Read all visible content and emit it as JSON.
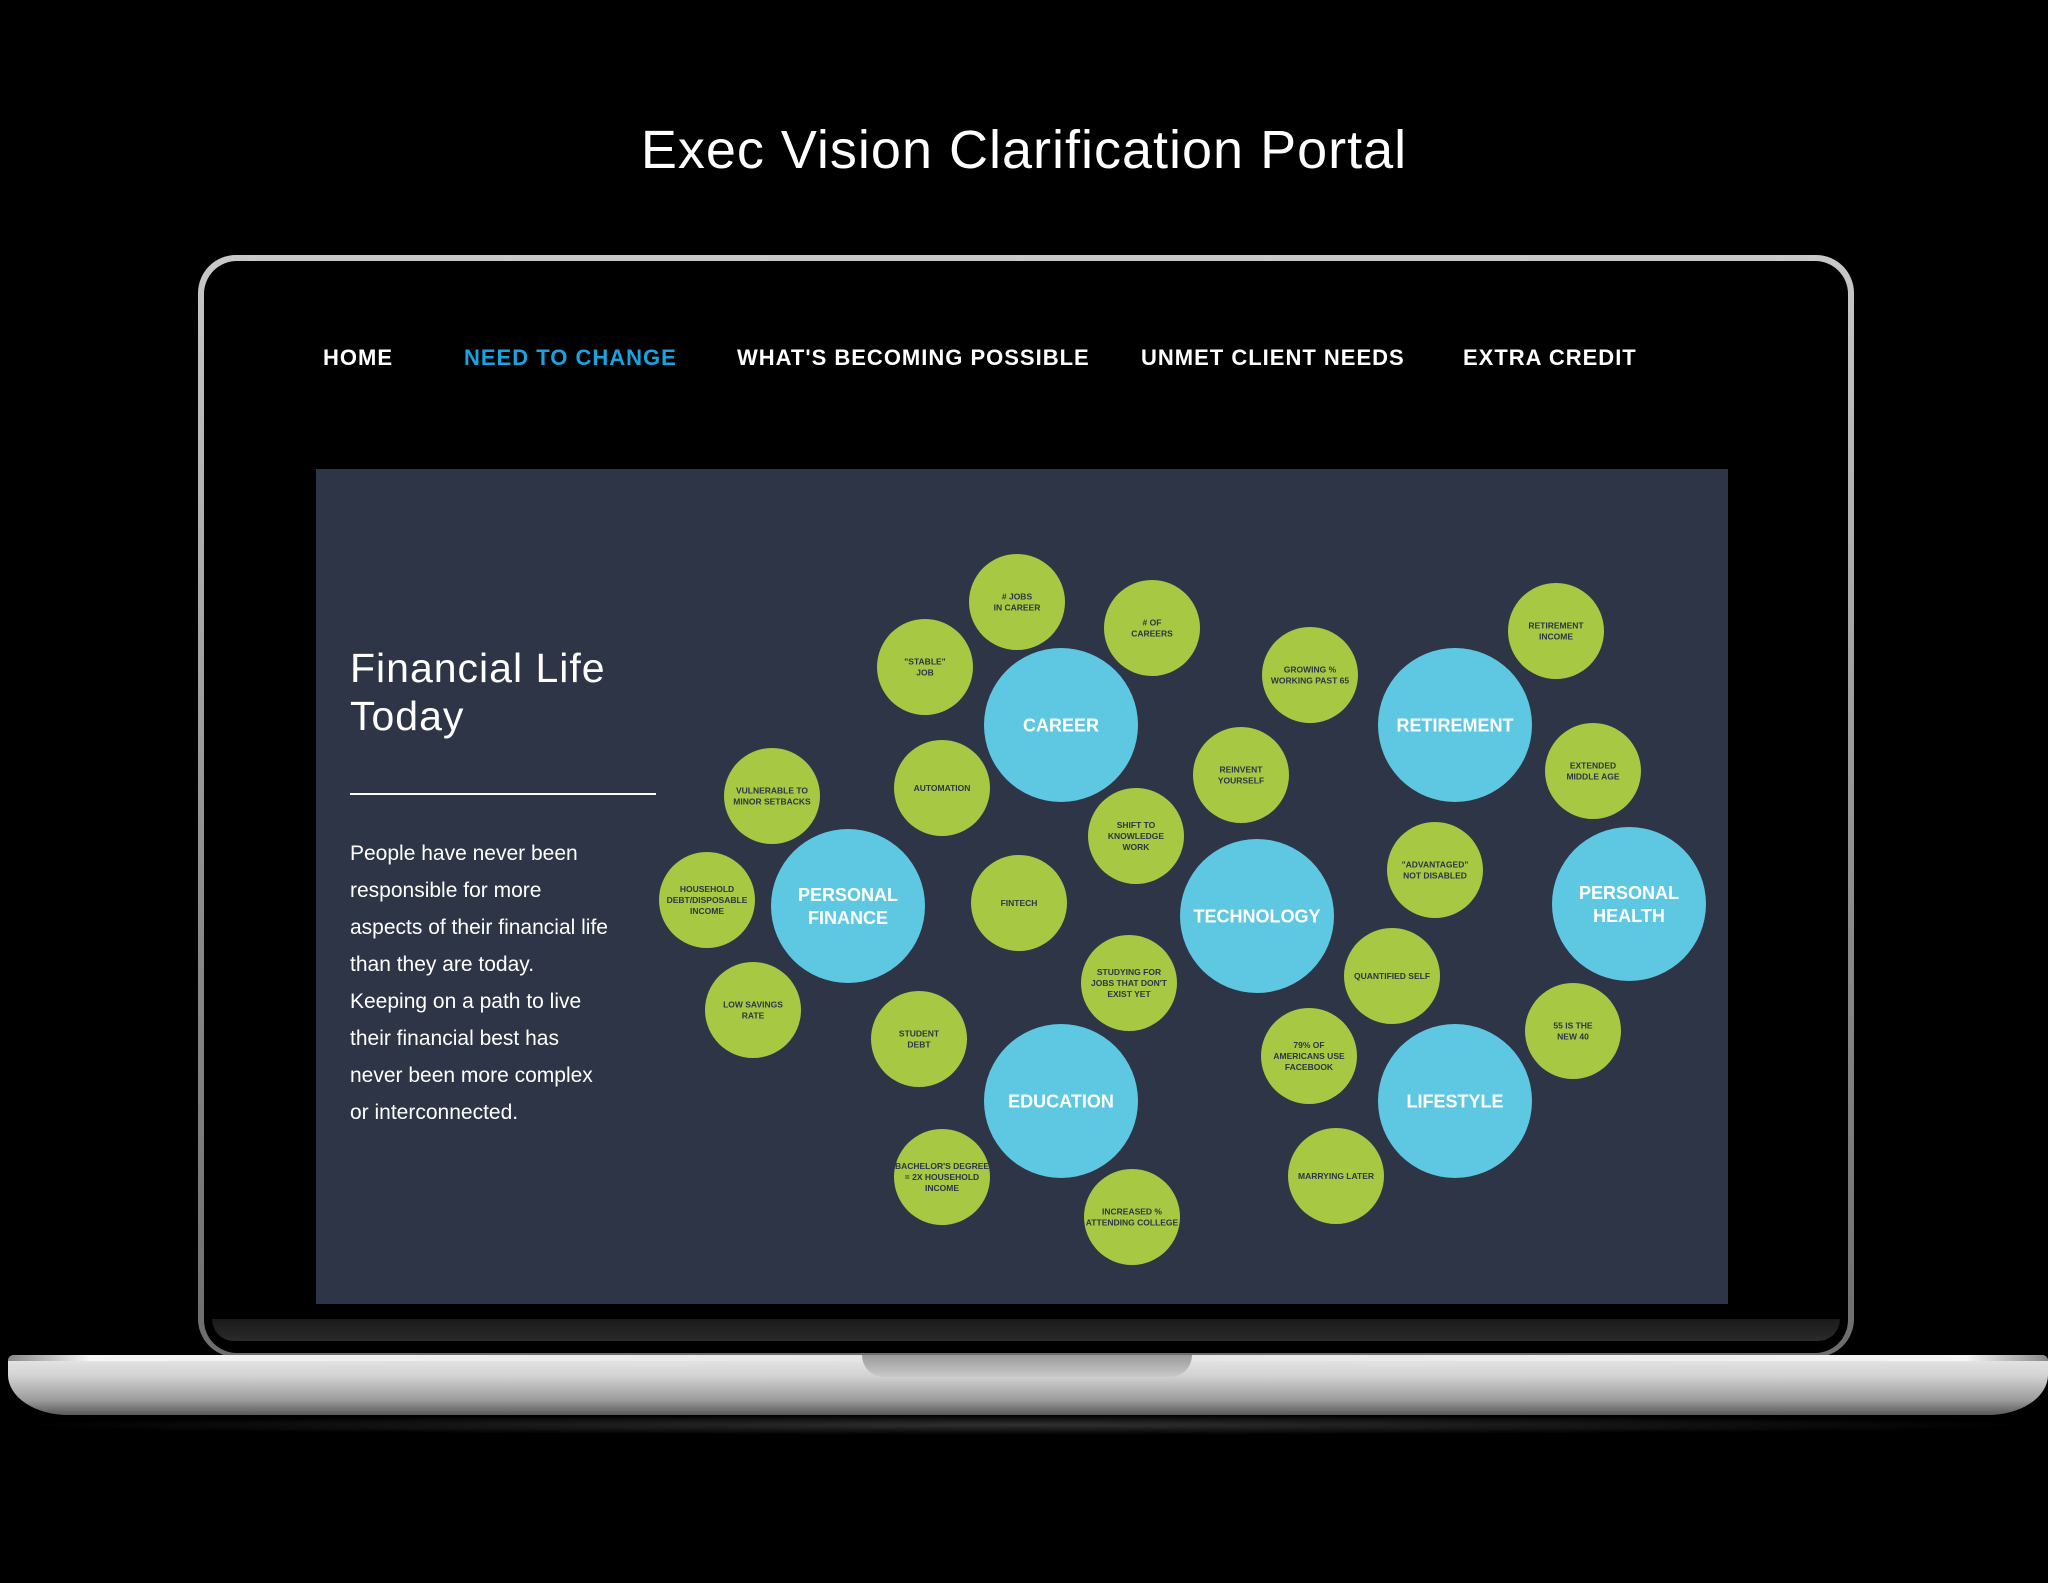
{
  "page_title": "Exec Vision Clarification Portal",
  "nav": {
    "items": [
      {
        "label": "HOME",
        "active": false
      },
      {
        "label": "NEED TO CHANGE",
        "active": true
      },
      {
        "label": "WHAT'S BECOMING POSSIBLE",
        "active": false
      },
      {
        "label": "UNMET CLIENT NEEDS",
        "active": false
      },
      {
        "label": "EXTRA CREDIT",
        "active": false
      }
    ]
  },
  "panel": {
    "heading_line1": "Financial Life",
    "heading_line2": "Today",
    "body_lines": [
      "People have never been",
      "responsible for more",
      "aspects of their financial life",
      "than they are today.",
      "Keeping on a path to live",
      "their financial best has",
      "never been more complex",
      "or interconnected."
    ]
  },
  "colors": {
    "background": "#000000",
    "panel": "#2d3546",
    "accent_blue": "#1aa3e0",
    "main_bubble": "#5ec8e3",
    "sub_bubble": "#a7c843",
    "sub_bubble_text": "#2d3546"
  },
  "bubbles": {
    "main": [
      {
        "id": "career",
        "lines": [
          "CAREER"
        ]
      },
      {
        "id": "retirement",
        "lines": [
          "RETIREMENT"
        ]
      },
      {
        "id": "personal-finance",
        "lines": [
          "PERSONAL",
          "FINANCE"
        ]
      },
      {
        "id": "technology",
        "lines": [
          "TECHNOLOGY"
        ]
      },
      {
        "id": "personal-health",
        "lines": [
          "PERSONAL",
          "HEALTH"
        ]
      },
      {
        "id": "education",
        "lines": [
          "EDUCATION"
        ]
      },
      {
        "id": "lifestyle",
        "lines": [
          "LIFESTYLE"
        ]
      }
    ],
    "sub": [
      {
        "id": "jobs-in-career",
        "lines": [
          "# JOBS",
          "IN CAREER"
        ]
      },
      {
        "id": "of-careers",
        "lines": [
          "# OF",
          "CAREERS"
        ]
      },
      {
        "id": "stable-job",
        "lines": [
          "\"STABLE\"",
          "JOB"
        ]
      },
      {
        "id": "retirement-income",
        "lines": [
          "RETIREMENT",
          "INCOME"
        ]
      },
      {
        "id": "growing-working",
        "lines": [
          "GROWING %",
          "WORKING PAST 65"
        ]
      },
      {
        "id": "vulnerable",
        "lines": [
          "VULNERABLE TO",
          "MINOR SETBACKS"
        ]
      },
      {
        "id": "automation",
        "lines": [
          "AUTOMATION"
        ]
      },
      {
        "id": "reinvent",
        "lines": [
          "REINVENT",
          "YOURSELF"
        ]
      },
      {
        "id": "extended-middle-age",
        "lines": [
          "EXTENDED",
          "MIDDLE AGE"
        ]
      },
      {
        "id": "knowledge-work",
        "lines": [
          "SHIFT TO",
          "KNOWLEDGE",
          "WORK"
        ]
      },
      {
        "id": "advantaged",
        "lines": [
          "\"ADVANTAGED\"",
          "NOT DISABLED"
        ]
      },
      {
        "id": "household-debt",
        "lines": [
          "HOUSEHOLD",
          "DEBT/DISPOSABLE",
          "INCOME"
        ]
      },
      {
        "id": "fintech",
        "lines": [
          "FINTECH"
        ]
      },
      {
        "id": "quantified-self",
        "lines": [
          "QUANTIFIED SELF"
        ]
      },
      {
        "id": "studying-jobs",
        "lines": [
          "STUDYING FOR",
          "JOBS THAT DON'T",
          "EXIST YET"
        ]
      },
      {
        "id": "low-savings",
        "lines": [
          "LOW SAVINGS",
          "RATE"
        ]
      },
      {
        "id": "student-debt",
        "lines": [
          "STUDENT",
          "DEBT"
        ]
      },
      {
        "id": "55-new-40",
        "lines": [
          "55 IS THE",
          "NEW 40"
        ]
      },
      {
        "id": "americans-facebook",
        "lines": [
          "79% OF",
          "AMERICANS USE",
          "FACEBOOK"
        ]
      },
      {
        "id": "bachelors",
        "lines": [
          "BACHELOR'S DEGREE",
          "= 2X HOUSEHOLD",
          "INCOME"
        ]
      },
      {
        "id": "marrying-later",
        "lines": [
          "MARRYING LATER"
        ]
      },
      {
        "id": "attending-college",
        "lines": [
          "INCREASED %",
          "ATTENDING COLLEGE"
        ]
      }
    ]
  }
}
